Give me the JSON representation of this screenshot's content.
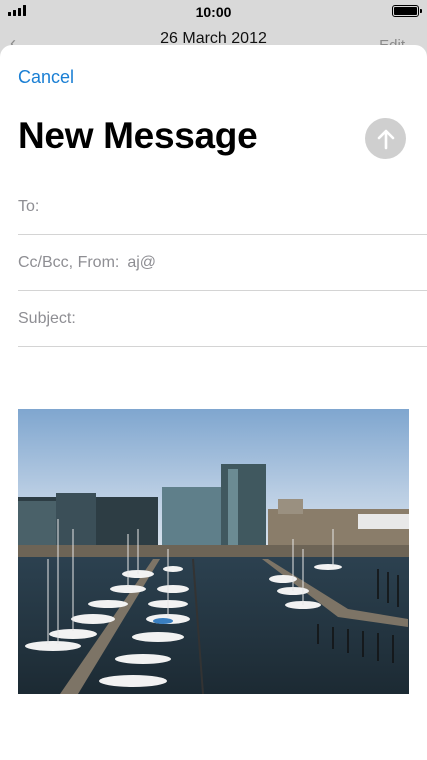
{
  "status_bar": {
    "time": "10:00",
    "signal_icon": "signal-bars-icon",
    "battery_icon": "battery-full-icon"
  },
  "background_screen": {
    "title": "26 March 2012",
    "edit_label": "Edit",
    "back_icon": "chevron-left-icon"
  },
  "compose": {
    "cancel_label": "Cancel",
    "title": "New Message",
    "send_icon": "arrow-up-icon",
    "to_label": "To:",
    "cc_label": "Cc/Bcc, From:",
    "from_value": "aj@",
    "subject_label": "Subject:",
    "attachment_icon": "photo-marina-image"
  },
  "colors": {
    "accent": "#1a7fd4",
    "send_disabled": "#cfcfcf"
  }
}
